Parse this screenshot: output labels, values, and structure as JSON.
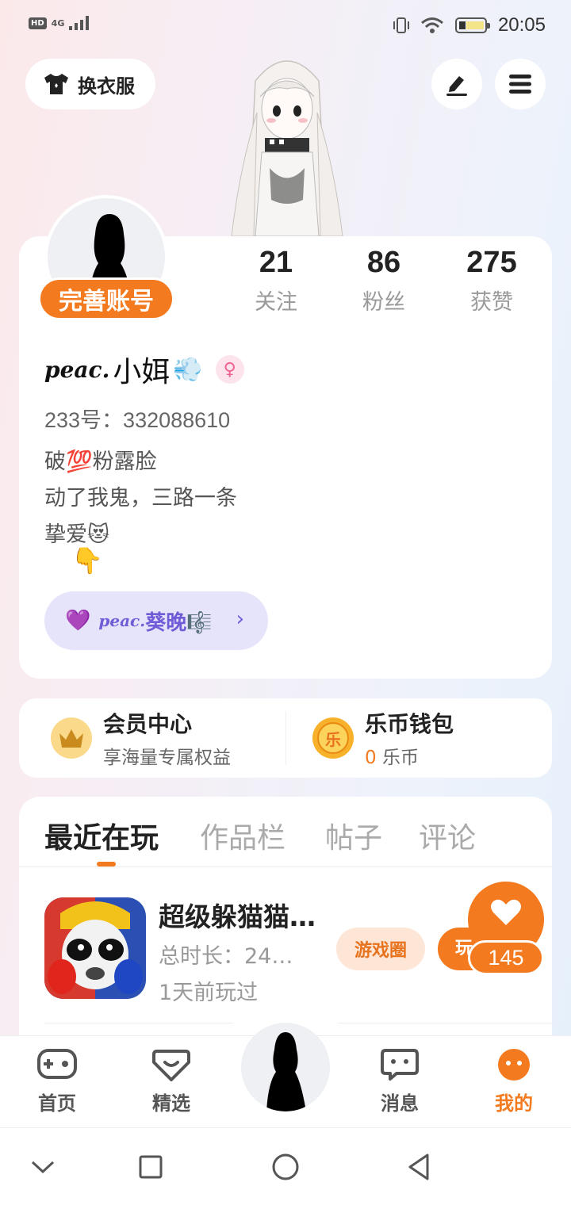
{
  "status_bar": {
    "hd": "HD",
    "network": "4G",
    "time": "20:05"
  },
  "top": {
    "outfit_label": "换衣服"
  },
  "profile": {
    "complete_account": "完善账号",
    "stats": [
      {
        "num": "21",
        "label": "关注"
      },
      {
        "num": "86",
        "label": "粉丝"
      },
      {
        "num": "275",
        "label": "获赞"
      }
    ],
    "name_prefix": "peac.",
    "name": "小㛅",
    "name_emoji": "💨",
    "gender_symbol": "♀",
    "uid": "233号：332088610",
    "bio": [
      "破💯粉露脸",
      "动了我鬼，三路一条",
      "挚爱😻"
    ],
    "bio_emoji": "👇",
    "couple": {
      "heart": "💜",
      "prefix": "peac.",
      "name": "葵晚🎼",
      "chevron": "›"
    }
  },
  "member": {
    "vip_title": "会员中心",
    "vip_sub": "享海量专属权益",
    "wallet_title": "乐币钱包",
    "wallet_icon_text": "乐",
    "wallet_amount": "0",
    "wallet_unit": " 乐币"
  },
  "tabs": [
    "最近在玩",
    "作品栏",
    "帖子",
    "评论"
  ],
  "game": {
    "title": "超级躲猫猫…",
    "duration": "总时长：24…",
    "last_played": "1天前玩过",
    "tag": "游戏圈",
    "play": "玩",
    "likes": "145"
  },
  "nav": [
    {
      "label": "首页",
      "icon": "gamepad-icon"
    },
    {
      "label": "精选",
      "icon": "heart-chat-icon"
    },
    {
      "label": "消息",
      "icon": "message-icon"
    },
    {
      "label": "我的",
      "icon": "profile-dots-icon"
    }
  ],
  "colors": {
    "accent": "#f47a1f",
    "purple": "#6f5cd6",
    "pill": "#e6e4fb"
  }
}
